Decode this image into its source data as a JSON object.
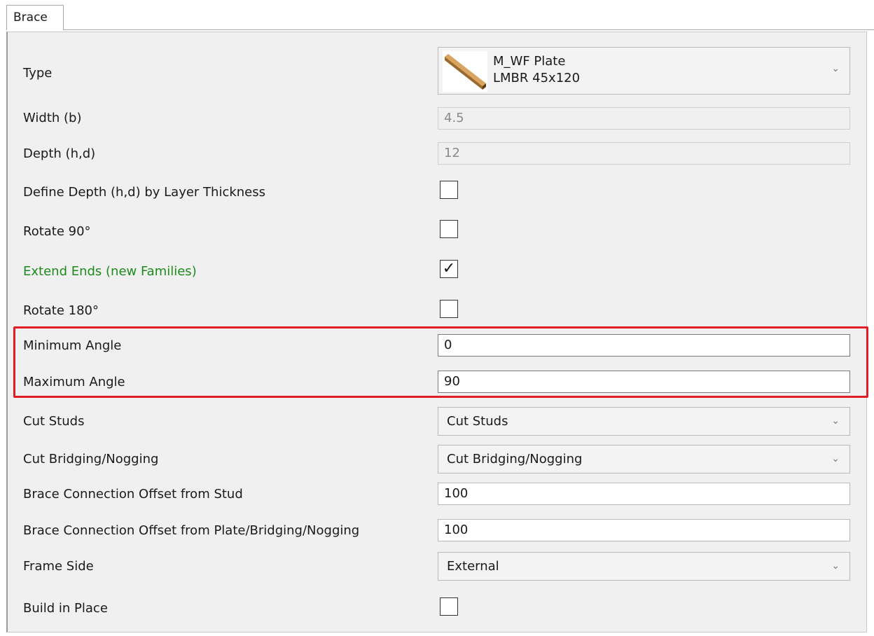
{
  "tab": {
    "label": "Brace"
  },
  "properties": {
    "type": {
      "label": "Type",
      "line1": "M_WF Plate",
      "line2": "LMBR 45x120",
      "icon": "wood-plate-icon"
    },
    "width": {
      "label": "Width (b)",
      "value": "4.5"
    },
    "depth": {
      "label": "Depth (h,d)",
      "value": "12"
    },
    "define_depth": {
      "label": "Define Depth (h,d) by Layer Thickness",
      "checked": false
    },
    "rotate90": {
      "label": "Rotate 90°",
      "checked": false
    },
    "extend_ends": {
      "label": "Extend Ends (new Families)",
      "checked": true,
      "check_mark": "✓",
      "label_color": "#1e8a1e"
    },
    "rotate180": {
      "label": "Rotate 180°",
      "checked": false
    },
    "min_angle": {
      "label": "Minimum Angle",
      "value": "0"
    },
    "max_angle": {
      "label": "Maximum Angle",
      "value": "90"
    },
    "cut_studs": {
      "label": "Cut Studs",
      "value": "Cut Studs"
    },
    "cut_bridging": {
      "label": "Cut Bridging/Nogging",
      "value": "Cut Bridging/Nogging"
    },
    "offset_stud": {
      "label": "Brace Connection Offset from Stud",
      "value": "100"
    },
    "offset_plate": {
      "label": "Brace Connection Offset from Plate/Bridging/Nogging",
      "value": "100"
    },
    "frame_side": {
      "label": "Frame Side",
      "value": "External"
    },
    "build_in_place": {
      "label": "Build in Place",
      "checked": false
    }
  },
  "colors": {
    "highlight": "#e01e24",
    "panel": "#f0f0f0"
  }
}
